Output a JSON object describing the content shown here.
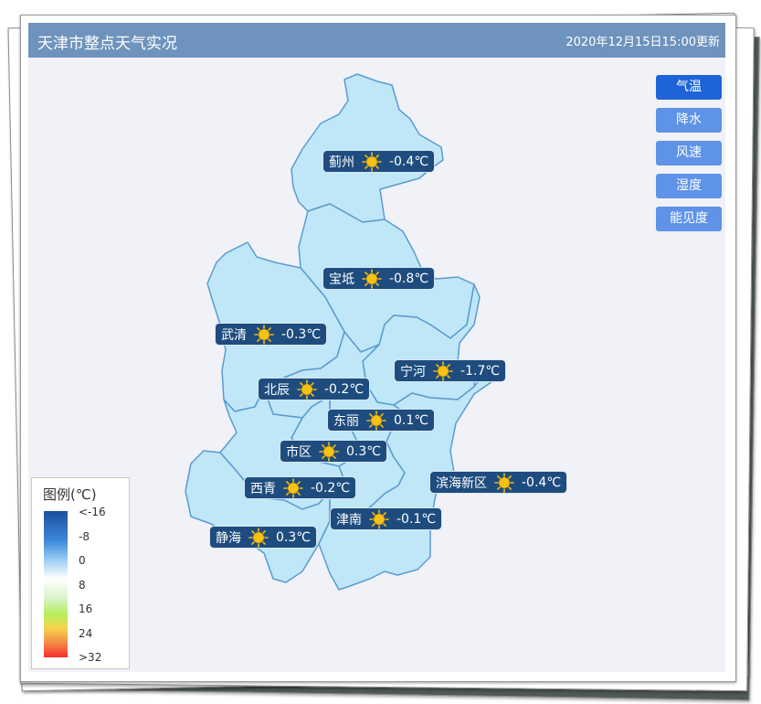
{
  "header": {
    "title": "天津市整点天气实况",
    "updated": "2020年12月15日15:00更新"
  },
  "layers": [
    {
      "label": "气温",
      "active": true
    },
    {
      "label": "降水",
      "active": false
    },
    {
      "label": "风速",
      "active": false
    },
    {
      "label": "湿度",
      "active": false
    },
    {
      "label": "能见度",
      "active": false
    }
  ],
  "stations": [
    {
      "name": "蓟州",
      "weather": "sunny-icon",
      "temp": "-0.4℃"
    },
    {
      "name": "宝坻",
      "weather": "sunny-icon",
      "temp": "-0.8℃"
    },
    {
      "name": "武清",
      "weather": "sunny-icon",
      "temp": "-0.3℃"
    },
    {
      "name": "宁河",
      "weather": "sunny-icon",
      "temp": "-1.7℃"
    },
    {
      "name": "北辰",
      "weather": "sunny-icon",
      "temp": "-0.2℃"
    },
    {
      "name": "东丽",
      "weather": "sunny-icon",
      "temp": "0.1℃"
    },
    {
      "name": "市区",
      "weather": "sunny-icon",
      "temp": "0.3℃"
    },
    {
      "name": "滨海新区",
      "weather": "sunny-icon",
      "temp": "-0.4℃"
    },
    {
      "name": "西青",
      "weather": "sunny-icon",
      "temp": "-0.2℃"
    },
    {
      "name": "津南",
      "weather": "sunny-icon",
      "temp": "-0.1℃"
    },
    {
      "name": "静海",
      "weather": "sunny-icon",
      "temp": "0.3℃"
    }
  ],
  "legend": {
    "title": "图例(℃)",
    "ticks": [
      "<-16",
      "-8",
      "0",
      "8",
      "16",
      "24",
      ">32"
    ]
  },
  "colors": {
    "region_fill": "#bfe7f7",
    "region_stroke": "#5b9bd0",
    "label_bg": "#1e4c7e",
    "button": "#5e93e8",
    "button_active": "#1f63d8",
    "header": "#6e93bd"
  }
}
